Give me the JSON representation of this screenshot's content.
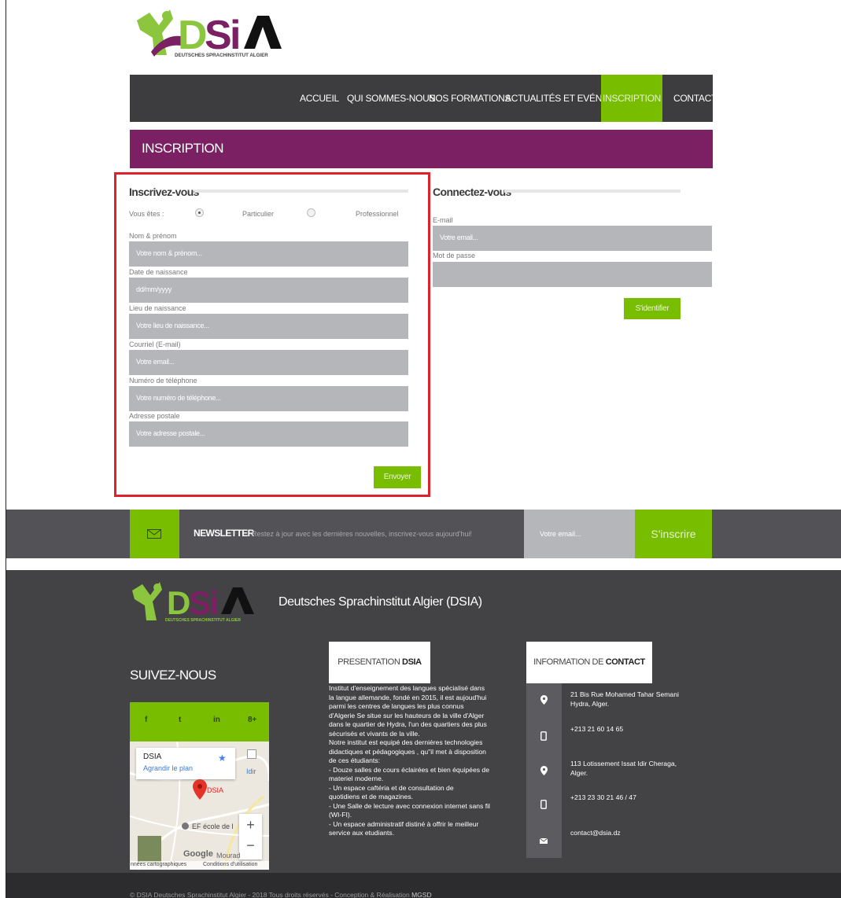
{
  "brand": {
    "logo_letters": "DSiA",
    "logo_tagline": "DEUTSCHES SPRACHINSTITUT ALGIER",
    "footer_tagline": "DEUTSCHES SPRACHINSTITUT ALGIER"
  },
  "nav": {
    "items": [
      "ACCUEIL",
      "QUI SOMMES-NOUS",
      "NOS FORMATIONS",
      "ACTUALITÉS ET EVÉNEMENTS",
      "INSCRIPTION",
      "CONTACT"
    ],
    "active": "INSCRIPTION"
  },
  "banner": {
    "title": "INSCRIPTION"
  },
  "register": {
    "title": "Inscrivez-vous",
    "vous_etes": "Vous êtes :",
    "options": [
      "Particulier",
      "Professionnel"
    ],
    "selected": "Particulier",
    "fields": [
      {
        "label": "Nom & prénom",
        "placeholder": "Votre nom & prénom..."
      },
      {
        "label": "Date de naissance",
        "placeholder": "dd/mm/yyyy"
      },
      {
        "label": "Lieu de naissance",
        "placeholder": "Votre lieu de naissance..."
      },
      {
        "label": "Courriel (E-mail)",
        "placeholder": "Votre email..."
      },
      {
        "label": "Numéro de téléphone",
        "placeholder": "Votre numéro de téléphone..."
      },
      {
        "label": "Adresse postale",
        "placeholder": "Votre adresse postale..."
      }
    ],
    "submit": "Envoyer"
  },
  "login": {
    "title": "Connectez-vous",
    "email_label": "E-mail",
    "email_placeholder": "Votre email...",
    "password_label": "Mot de passe",
    "password_placeholder": "",
    "submit": "S'identifier"
  },
  "newsletter": {
    "title": "NEWSLETTER",
    "text": "Restez à jour avec les dernières nouvelles, inscrivez-vous aujourd'hui!",
    "placeholder": "Votre email...",
    "button": "S'inscrire"
  },
  "footer": {
    "title": "Deutsches Sprachinstitut Algier (DSIA)",
    "follow": "SUIVEZ-NOUS",
    "social": [
      "f",
      "t",
      "in",
      "8+"
    ],
    "map": {
      "place": "DSIA",
      "enlarge": "Agrandir le plan",
      "marker": "DSIA",
      "poi": "EF école de l",
      "metro": "Idir",
      "street": "Mourad",
      "google": "Google",
      "data": "nnées cartographiques",
      "terms": "Conditions d'utilisation"
    },
    "presentation": {
      "head_plain": "PRESENTATION ",
      "head_bold": "DSIA",
      "lines": [
        "Institut d'enseignement des langues spécialisé dans",
        "la langue allemande, fondé en 2015, il est aujoud'hui",
        "parmi les centres de langues les plus connus",
        "d'Algerie Se situe sur les hauteurs de la ville d'Alger",
        "dans le quartier de Hydra, l'un des quartiers des plus",
        "sécurisés et vivants de la ville.",
        "Notre institut est equipé des derniéres technologies",
        "didactiques et pédagogiques , qu\"il met à disposition",
        "de ces étudiants:",
        "- Douze salles de cours éclairées et bien équipées de",
        "materiel moderne.",
        "- Un espace caftéria et de consultation de",
        "quotidiens et de magazines.",
        "- Une Salle de lecture avec connexion internet sans fil",
        "(WI-FI).",
        "- Un espace administratif distiné à offrir le meilleur",
        "service aux etudiants."
      ]
    },
    "contact": {
      "head_plain": "INFORMATION DE ",
      "head_bold": "CONTACT",
      "address1_line1": "21 Bis Rue Mohamed Tahar Semani",
      "address1_line2": "Hydra, Alger.",
      "phone1": "+213 21 60 14 65",
      "address2_line1": "113 Lotissement Issat Idir Cheraga,",
      "address2_line2": "Alger.",
      "phone2": "+213 23 30 21 46 / 47",
      "email": "contact@dsia.dz"
    },
    "copyright_text": "© DSIA Deutsches Sprachinstitut Algier - 2018 Tous droits réservés - Conception & Réalisation ",
    "copyright_credit": "MGSD"
  },
  "colors": {
    "green": "#78bd00",
    "purple": "#7b2163",
    "dark": "#3d3d3f",
    "field": "#b5b6ba",
    "highlight": "#e0202a"
  },
  "icons": [
    "map-pin-icon",
    "mobile-icon",
    "envelope-icon",
    "google-map-marker-icon",
    "star-icon"
  ]
}
